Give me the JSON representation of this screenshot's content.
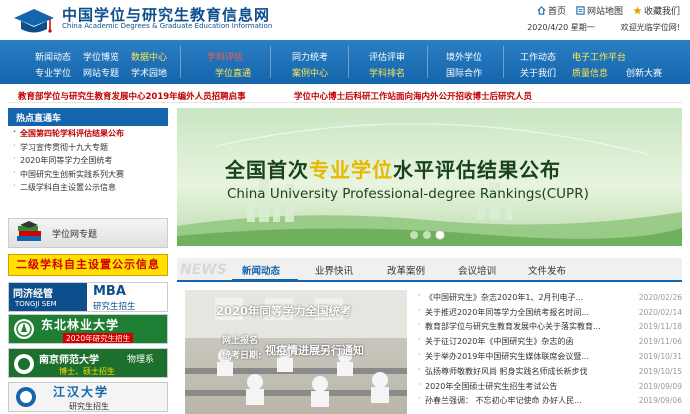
{
  "header": {
    "title": "中国学位与研究生教育信息网",
    "subtitle": "China Academic Degrees & Graduate Education Information",
    "links": [
      "首页",
      "网站地图",
      "收藏我们"
    ],
    "date": "2020/4/20 星期一",
    "welcome": "欢迎光临学位网!"
  },
  "nav": {
    "group1": {
      "row1": [
        "新闻动态",
        "学位博览",
        "数据中心"
      ],
      "row2": [
        "专业学位",
        "网站专题",
        "学术园地"
      ]
    },
    "group2": {
      "row1": [
        "学科评估"
      ],
      "row2": [
        "学位直通"
      ]
    },
    "group3": {
      "row1": [
        "同力统考"
      ],
      "row2": [
        "案例中心"
      ]
    },
    "group4": {
      "row1": [
        "评估评审"
      ],
      "row2": [
        "学科排名"
      ]
    },
    "group5": {
      "row1": [
        "境外学位"
      ],
      "row2": [
        "国际合作"
      ]
    },
    "group6": {
      "row1": [
        "工作动态",
        "电子工作平台"
      ],
      "row2": [
        "关于我们",
        "质量信息",
        "创新大赛"
      ]
    }
  },
  "announcements": [
    "教育部学位与研究生教育发展中心2019年编外人员招聘启事",
    "学位中心博士后科研工作站面向海内外公开招收博士后研究人员"
  ],
  "sidebar": {
    "hot_title": "热点直通车",
    "hot_items": [
      "全国第四轮学科评估结果公布",
      "学习宣传贯彻十九大专题",
      "2020年同等学力全国统考",
      "中国研究生创新实践系列大赛",
      "二级学科自主设置公示信息"
    ],
    "topic_label": "学位网专题",
    "banner": "二级学科自主设置公示信息",
    "ads": [
      {
        "brand": "同济经管",
        "brand_en": "TONGJI SEM",
        "mba": "MBA",
        "text": "研究生招生"
      },
      {
        "title": "东北林业大学",
        "text": "2020年研究生招生"
      },
      {
        "title": "南京师范大学",
        "dept": "物理系",
        "text": "博士、硕士招生"
      },
      {
        "title": "江汉大学",
        "text": "研究生招生"
      }
    ]
  },
  "hero": {
    "title_a": "全国首次",
    "title_em": "专业学位",
    "title_b": "水平评估结果公布",
    "subtitle": "China University Professional-degree Rankings(CUPR)",
    "slides": 3,
    "active_slide": 2
  },
  "tabs": {
    "en_label": "NEWS",
    "items": [
      "新闻动态",
      "业界快讯",
      "改革案例",
      "会议培训",
      "文件发布"
    ],
    "active": 0
  },
  "feature": {
    "title": "2020年同等学力全国统考",
    "line1": "网上报名",
    "line2": "统考日期:",
    "big": "视疫情进展另行通知"
  },
  "news": [
    {
      "title": "《中国研究生》杂志2020年1、2月刊电子...",
      "date": "2020/02/26"
    },
    {
      "title": "关于推迟2020年同等学力全国统考报名时间...",
      "date": "2020/02/14"
    },
    {
      "title": "教育部学位与研究生教育发展中心关于落实教育...",
      "date": "2019/11/18"
    },
    {
      "title": "关于征订2020年《中国研究生》杂志的函",
      "date": "2019/11/06"
    },
    {
      "title": "关于举办2019年中国研究生媒体联席会议暨...",
      "date": "2019/10/31"
    },
    {
      "title": "弘扬尊师敬教好风尚 躬身实践名师成长新步伐",
      "date": "2019/10/15"
    },
    {
      "title": "2020年全国硕士研究生招生考试公告",
      "date": "2019/09/09"
    },
    {
      "title": "孙春兰强调： 不忘初心牢记使命 办好人民...",
      "date": "2019/09/06"
    }
  ]
}
